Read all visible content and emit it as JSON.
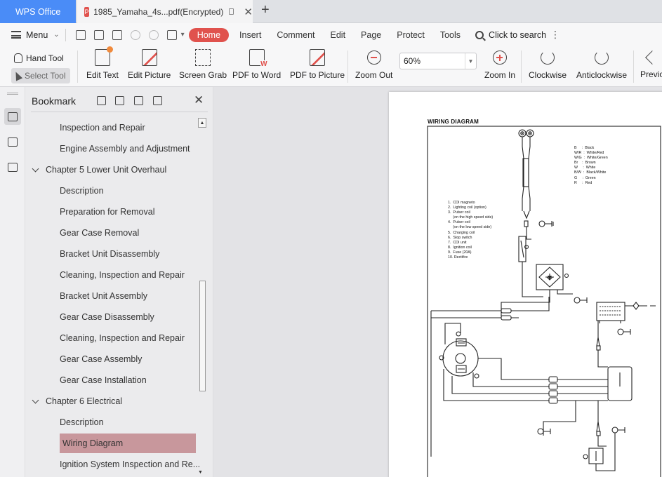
{
  "app": {
    "name": "WPS Office",
    "tab_title": "1985_Yamaha_4s...pdf(Encrypted)",
    "pdf_badge": "P"
  },
  "menubar": {
    "menu_label": "Menu",
    "tabs": [
      "Home",
      "Insert",
      "Comment",
      "Edit",
      "Page",
      "Protect",
      "Tools"
    ],
    "active_tab": "Home",
    "search_label": "Click to search",
    "accent_color": "#e0524d"
  },
  "ribbon": {
    "hand_tool": "Hand Tool",
    "select_tool": "Select Tool",
    "edit_text": "Edit Text",
    "edit_picture": "Edit Picture",
    "screen_grab": "Screen Grab",
    "pdf_to_word": "PDF to Word",
    "pdf_to_picture": "PDF to Picture",
    "zoom_out": "Zoom Out",
    "zoom_value": "60%",
    "zoom_in": "Zoom In",
    "clockwise": "Clockwise",
    "anticlockwise": "Anticlockwise",
    "previous": "Previo"
  },
  "bookmark_panel": {
    "title": "Bookmark",
    "items": [
      {
        "label": "Inspection and Repair",
        "level": 2
      },
      {
        "label": "Engine Assembly and Adjustment",
        "level": 2
      },
      {
        "label": "Chapter 5 Lower Unit Overhaul",
        "level": 1
      },
      {
        "label": "Description",
        "level": 2
      },
      {
        "label": "Preparation for Removal",
        "level": 2
      },
      {
        "label": "Gear Case Removal",
        "level": 2
      },
      {
        "label": "Bracket Unit Disassembly",
        "level": 2
      },
      {
        "label": "Cleaning, Inspection and Repair",
        "level": 2
      },
      {
        "label": "Bracket Unit Assembly",
        "level": 2
      },
      {
        "label": "Gear Case Disassembly",
        "level": 2
      },
      {
        "label": "Cleaning, Inspection and Repair",
        "level": 2
      },
      {
        "label": "Gear Case Assembly",
        "level": 2
      },
      {
        "label": "Gear Case Installation",
        "level": 2
      },
      {
        "label": "Chapter 6 Electrical",
        "level": 1
      },
      {
        "label": "Description",
        "level": 2
      },
      {
        "label": "Wiring Diagram",
        "level": 2,
        "selected": true
      },
      {
        "label": "Ignition System Inspection and Re...",
        "level": 2
      }
    ],
    "selected_color": "#c8979c"
  },
  "document": {
    "page_title": "WIRING DIAGRAM",
    "legend_text": "1.  CDI magneto\n2.  Lighting coil (option)\n3.  Pulser coil\n     (on the high speed side)\n4.  Pulser coil\n     (on the low speed side)\n5.  Charging coil\n6.  Stop switch\n7.  CDI unit\n8.  Ignition coil\n9.  Fuse (20A)\n10. Rectifire",
    "color_codes": "B     :  Black\nW/R  :  White/Red\nW/G  :  White/Green\nBr    :  Brown\nW     :  White\nB/W  :  Black/White\nG     :  Green\nR     :  Red"
  }
}
